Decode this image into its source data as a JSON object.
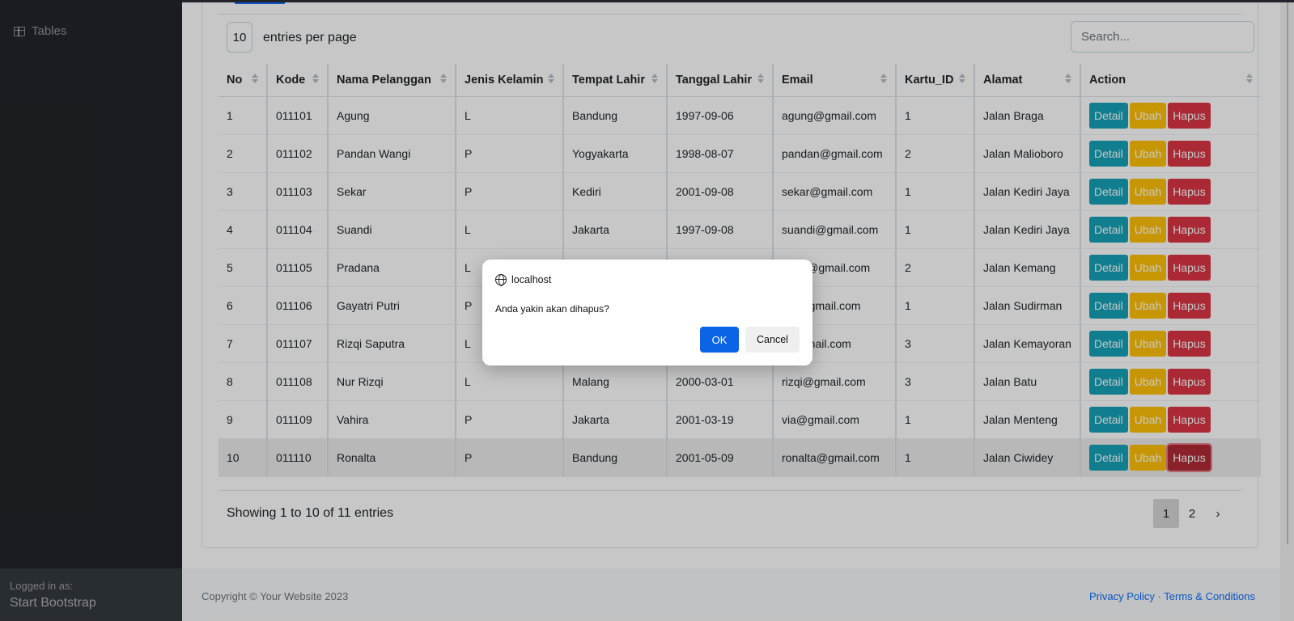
{
  "sidebar": {
    "nav_item": "Tables",
    "footer_small": "Logged in as:",
    "footer_name": "Start Bootstrap"
  },
  "controls": {
    "per_page_value": "10",
    "per_page_label": "entries per page",
    "search_placeholder": "Search..."
  },
  "table": {
    "headers": [
      "No",
      "Kode",
      "Nama Pelanggan",
      "Jenis Kelamin",
      "Tempat Lahir",
      "Tanggal Lahir",
      "Email",
      "Kartu_ID",
      "Alamat",
      "Action"
    ],
    "rows": [
      {
        "no": "1",
        "kode": "011101",
        "nama": "Agung",
        "jk": "L",
        "tempat": "Bandung",
        "tanggal": "1997-09-06",
        "email": "agung@gmail.com",
        "kartu": "1",
        "alamat": "Jalan Braga"
      },
      {
        "no": "2",
        "kode": "011102",
        "nama": "Pandan Wangi",
        "jk": "P",
        "tempat": "Yogyakarta",
        "tanggal": "1998-08-07",
        "email": "pandan@gmail.com",
        "kartu": "2",
        "alamat": "Jalan Malioboro"
      },
      {
        "no": "3",
        "kode": "011103",
        "nama": "Sekar",
        "jk": "P",
        "tempat": "Kediri",
        "tanggal": "2001-09-08",
        "email": "sekar@gmail.com",
        "kartu": "1",
        "alamat": "Jalan Kediri Jaya"
      },
      {
        "no": "4",
        "kode": "011104",
        "nama": "Suandi",
        "jk": "L",
        "tempat": "Jakarta",
        "tanggal": "1997-09-08",
        "email": "suandi@gmail.com",
        "kartu": "1",
        "alamat": "Jalan Kediri Jaya"
      },
      {
        "no": "5",
        "kode": "011105",
        "nama": "Pradana",
        "jk": "L",
        "tempat": "",
        "tanggal": "",
        "email": "dana@gmail.com",
        "kartu": "2",
        "alamat": "Jalan Kemang"
      },
      {
        "no": "6",
        "kode": "011106",
        "nama": "Gayatri Putri",
        "jk": "P",
        "tempat": "",
        "tanggal": "",
        "email": "atri@gmail.com",
        "kartu": "1",
        "alamat": "Jalan Sudirman"
      },
      {
        "no": "7",
        "kode": "011107",
        "nama": "Rizqi Saputra",
        "jk": "L",
        "tempat": "",
        "tanggal": "",
        "email": "a@gmail.com",
        "kartu": "3",
        "alamat": "Jalan Kemayoran"
      },
      {
        "no": "8",
        "kode": "011108",
        "nama": "Nur Rizqi",
        "jk": "L",
        "tempat": "Malang",
        "tanggal": "2000-03-01",
        "email": "rizqi@gmail.com",
        "kartu": "3",
        "alamat": "Jalan Batu"
      },
      {
        "no": "9",
        "kode": "011109",
        "nama": "Vahira",
        "jk": "P",
        "tempat": "Jakarta",
        "tanggal": "2001-03-19",
        "email": "via@gmail.com",
        "kartu": "1",
        "alamat": "Jalan Menteng"
      },
      {
        "no": "10",
        "kode": "011110",
        "nama": "Ronalta",
        "jk": "P",
        "tempat": "Bandung",
        "tanggal": "2001-05-09",
        "email": "ronalta@gmail.com",
        "kartu": "1",
        "alamat": "Jalan Ciwidey"
      }
    ],
    "actions": {
      "detail": "Detail",
      "ubah": "Ubah",
      "hapus": "Hapus"
    }
  },
  "info": "Showing 1 to 10 of 11 entries",
  "pagination": {
    "pages": [
      "1",
      "2"
    ],
    "next": "›"
  },
  "footer": {
    "copyright": "Copyright © Your Website 2023",
    "privacy": "Privacy Policy",
    "separator": "·",
    "terms": "Terms & Conditions"
  },
  "dialog": {
    "origin": "localhost",
    "message": "Anda yakin akan dihapus?",
    "ok": "OK",
    "cancel": "Cancel"
  },
  "colors": {
    "sidebar": "#212529",
    "detail": "#17a2b8",
    "ubah": "#ffc107",
    "hapus": "#dc3545",
    "primary": "#0b63e5"
  }
}
